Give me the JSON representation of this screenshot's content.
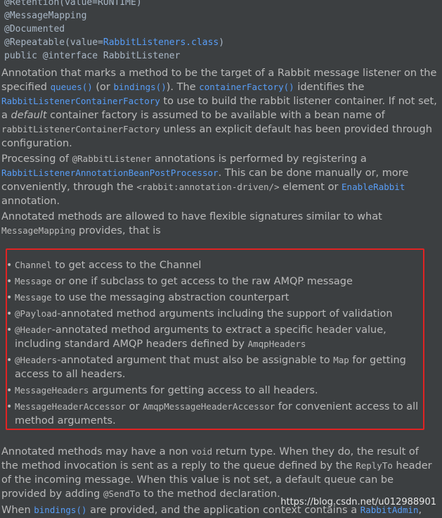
{
  "code": {
    "line0": "@Retention(value=RUNTIME)",
    "line1": "@MessageMapping",
    "line2": "@Documented",
    "line3_prefix": "@Repeatable(value=",
    "line3_link": "RabbitListeners.class",
    "line3_suffix": ")",
    "line4": "public @interface RabbitListener"
  },
  "para1": {
    "t1": "Annotation that marks a method to be the target of a Rabbit message listener on the specified ",
    "l1": "queues()",
    "t2": " (or ",
    "l2": "bindings()",
    "t3": "). The ",
    "l3": "containerFactory()",
    "t4": " identifies the ",
    "l4": "RabbitListenerContainerFactory",
    "t5": " to use to build the rabbit listener container. If not set, a ",
    "em": "default",
    "t6": " container factory is assumed to be available with a bean name of ",
    "c1": "rabbitListenerContainerFactory",
    "t7": " unless an explicit default has been provided through configuration."
  },
  "para2": {
    "t1": "Processing of ",
    "c1": "@RabbitListener",
    "t2": " annotations is performed by registering a ",
    "l1": "RabbitListenerAnnotationBeanPostProcessor",
    "t3": ". This can be done manually or, more conveniently, through the ",
    "c2": "<rabbit:annotation-driven/>",
    "t4": " element or ",
    "l2": "EnableRabbit",
    "t5": " annotation."
  },
  "para3": {
    "t1": "Annotated methods are allowed to have flexible signatures similar to what ",
    "c1": "MessageMapping",
    "t2": " provides, that is"
  },
  "bullets": {
    "b1": {
      "c1": "Channel",
      "t1": " to get access to the Channel"
    },
    "b2": {
      "c1": "Message",
      "t1": " or one if subclass to get access to the raw AMQP message"
    },
    "b3": {
      "c1": "Message",
      "t1": " to use the messaging abstraction counterpart"
    },
    "b4": {
      "c1": "@Payload",
      "t1": "-annotated method arguments including the support of validation"
    },
    "b5": {
      "c1": "@Header",
      "t1": "-annotated method arguments to extract a specific header value, including standard AMQP headers defined by ",
      "c2": "AmqpHeaders"
    },
    "b6": {
      "c1": "@Headers",
      "t1": "-annotated argument that must also be assignable to ",
      "c2": "Map",
      "t2": " for getting access to all headers."
    },
    "b7": {
      "c1": "MessageHeaders",
      "t1": " arguments for getting access to all headers."
    },
    "b8": {
      "c1": "MessageHeaderAccessor",
      "t1": " or ",
      "c2": "AmqpMessageHeaderAccessor",
      "t2": " for convenient access to all method arguments."
    }
  },
  "para4": {
    "t1": "Annotated methods may have a non ",
    "c1": "void",
    "t2": " return type. When they do, the result of the method invocation is sent as a reply to the queue defined by the ",
    "c2": "ReplyTo",
    "t3": " header of the incoming message. When this value is not set, a default queue can be provided by adding ",
    "c3": "@SendTo",
    "t4": " to the method declaration."
  },
  "para5": {
    "t1": "When ",
    "l1": "bindings()",
    "t2": " are provided, and the application context contains a ",
    "l2": "RabbitAdmin",
    "t3": ","
  },
  "watermark": "https://blog.csdn.net/u012988901",
  "colors": {
    "background": "#3c3f41",
    "text": "#bbbbbb",
    "link": "#589df6",
    "highlight_box": "#e02323"
  }
}
